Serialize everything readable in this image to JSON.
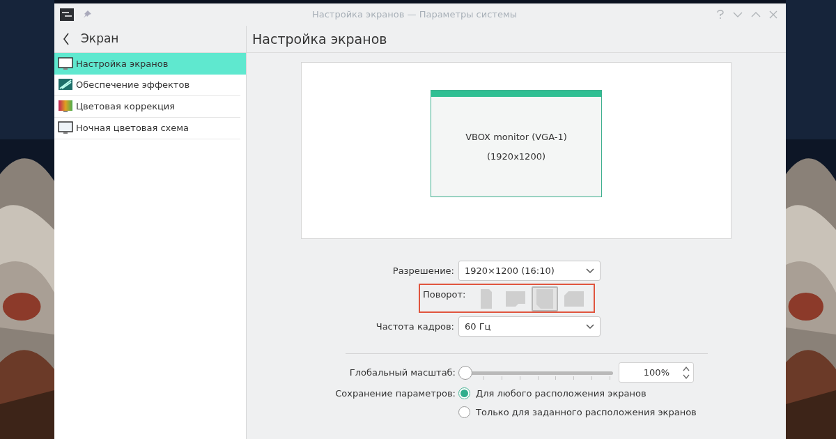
{
  "window": {
    "title": "Настройка экранов — Параметры системы"
  },
  "sidebar": {
    "back_label": "Экран",
    "items": [
      {
        "label": "Настройка экранов",
        "selected": true,
        "kind": "display"
      },
      {
        "label": "Обеспечение эффектов",
        "selected": false,
        "kind": "effects"
      },
      {
        "label": "Цветовая коррекция",
        "selected": false,
        "kind": "color"
      },
      {
        "label": "Ночная цветовая схема",
        "selected": false,
        "kind": "night"
      }
    ]
  },
  "page": {
    "heading": "Настройка экранов",
    "monitor": {
      "name": "VBOX monitor (VGA-1)",
      "resolution": "(1920x1200)"
    },
    "resolution": {
      "label": "Разрешение:",
      "value": "1920×1200 (16:10)"
    },
    "rotation": {
      "label": "Поворот:",
      "options": [
        {
          "selected": false
        },
        {
          "selected": false
        },
        {
          "selected": true
        },
        {
          "selected": false
        }
      ]
    },
    "refresh_rate": {
      "label": "Частота кадров:",
      "value": "60 Гц"
    },
    "scale": {
      "label": "Глобальный масштаб:",
      "level": 0,
      "value": "100%"
    },
    "save": {
      "label": "Сохранение параметров:",
      "options": [
        {
          "label": "Для любого расположения экранов",
          "selected": true
        },
        {
          "label": "Только для заданного расположения экранов",
          "selected": false
        }
      ]
    }
  }
}
